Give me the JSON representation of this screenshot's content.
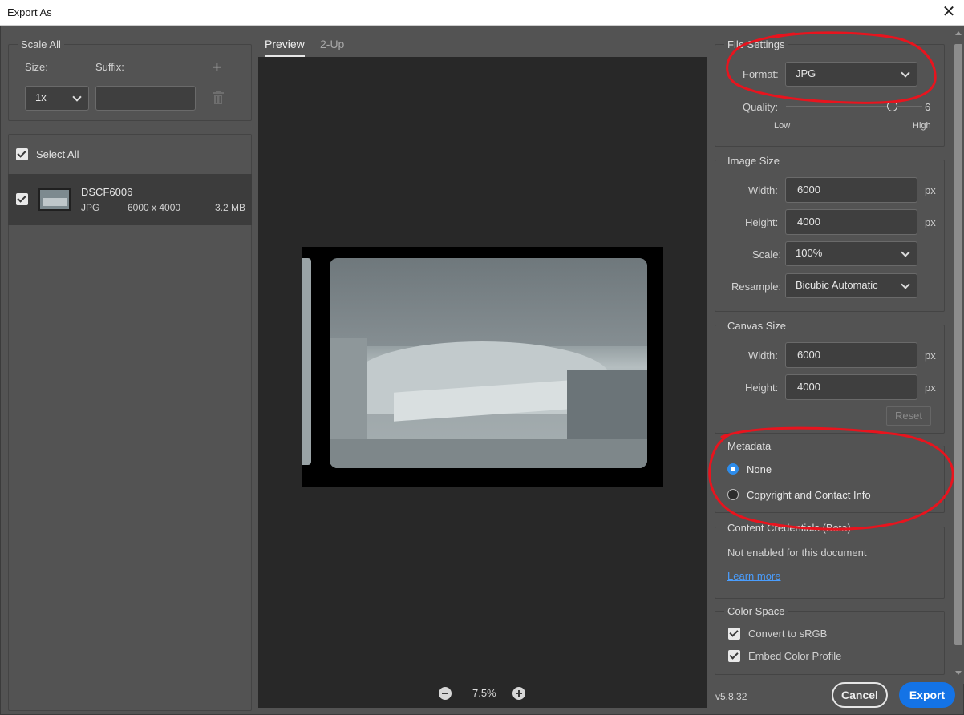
{
  "window": {
    "title": "Export As",
    "close_icon": "close-icon"
  },
  "scale": {
    "legend": "Scale All",
    "size_label": "Size:",
    "suffix_label": "Suffix:",
    "size_value": "1x",
    "suffix_value": "",
    "add_icon": "plus-icon",
    "delete_icon": "trash-icon"
  },
  "files": {
    "select_all": "Select All",
    "select_all_checked": true,
    "items": [
      {
        "name": "DSCF6006",
        "format": "JPG",
        "dimensions": "6000 x 4000",
        "size": "3.2 MB",
        "checked": true
      }
    ]
  },
  "preview": {
    "tabs": [
      {
        "label": "Preview",
        "active": true
      },
      {
        "label": "2-Up",
        "active": false
      }
    ],
    "zoom": "7.5%"
  },
  "file_settings": {
    "legend": "File Settings",
    "format_label": "Format:",
    "format_value": "JPG",
    "quality_label": "Quality:",
    "quality_value": "6",
    "quality_fraction": 0.9,
    "low": "Low",
    "high": "High"
  },
  "image_size": {
    "legend": "Image Size",
    "width_label": "Width:",
    "width_value": "6000",
    "height_label": "Height:",
    "height_value": "4000",
    "scale_label": "Scale:",
    "scale_value": "100%",
    "resample_label": "Resample:",
    "resample_value": "Bicubic Automatic",
    "unit": "px"
  },
  "canvas_size": {
    "legend": "Canvas Size",
    "width_label": "Width:",
    "width_value": "6000",
    "height_label": "Height:",
    "height_value": "4000",
    "unit": "px",
    "reset": "Reset"
  },
  "metadata": {
    "legend": "Metadata",
    "options": [
      {
        "label": "None",
        "selected": true
      },
      {
        "label": "Copyright and Contact Info",
        "selected": false
      }
    ]
  },
  "content_credentials": {
    "legend": "Content Credentials (Beta)",
    "status": "Not enabled for this document",
    "link": "Learn more"
  },
  "color_space": {
    "legend": "Color Space",
    "convert": "Convert to sRGB",
    "embed": "Embed Color Profile",
    "convert_checked": true,
    "embed_checked": true
  },
  "footer": {
    "version": "v5.8.32",
    "cancel": "Cancel",
    "export": "Export"
  },
  "colors": {
    "accent": "#1473e6",
    "annotation": "#e8141e",
    "panel": "#535353",
    "preview_bg": "#282828"
  }
}
